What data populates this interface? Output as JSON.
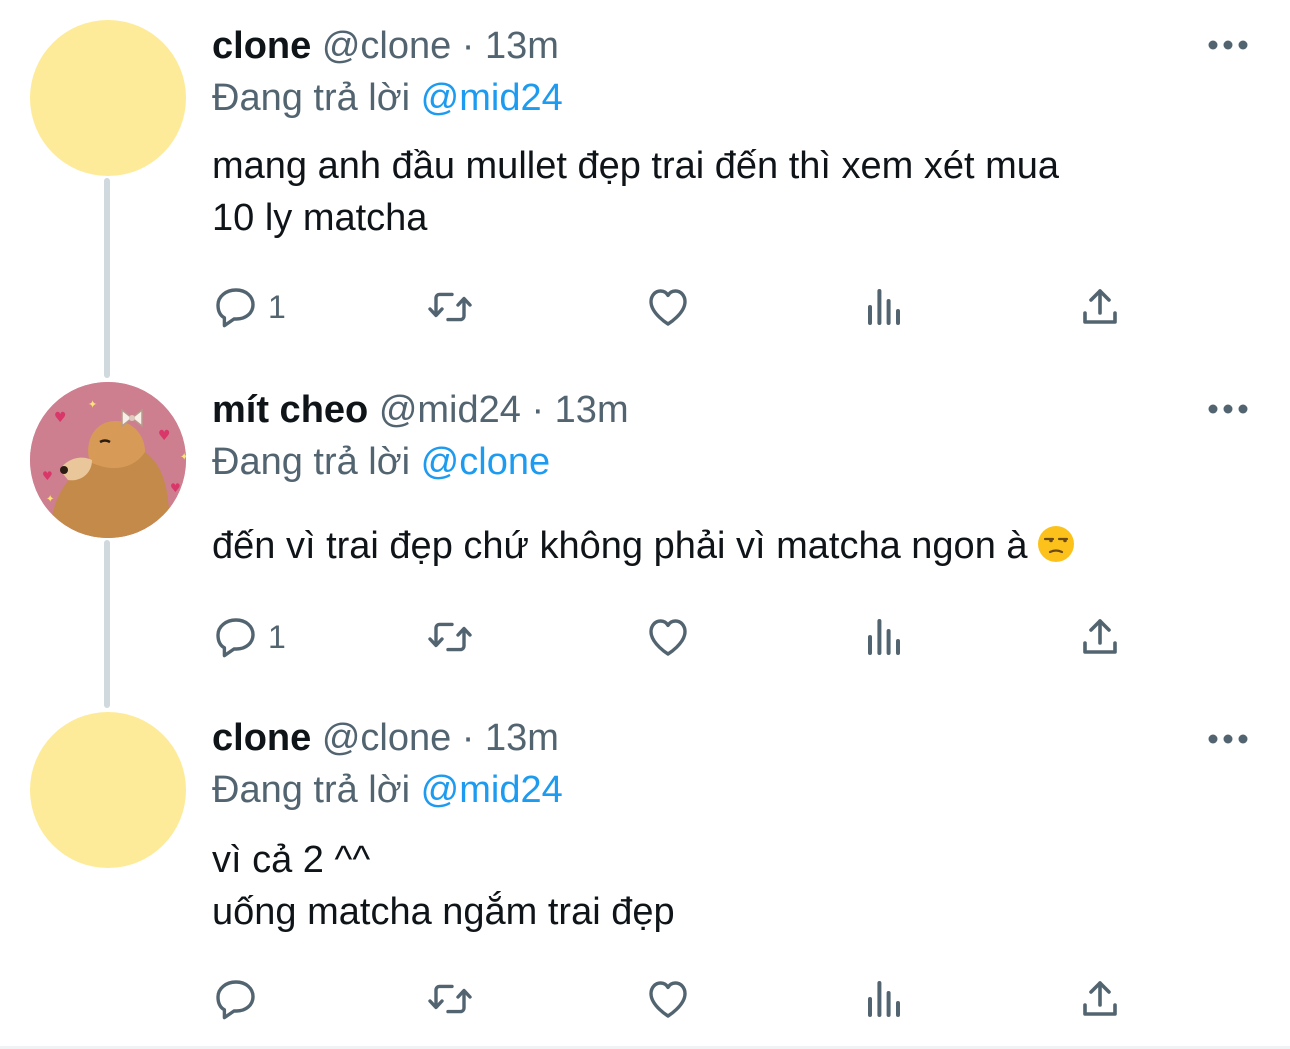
{
  "tweets": [
    {
      "name": "clone",
      "handle": "@clone",
      "separator": "·",
      "time": "13m",
      "reply_prefix": "Đang trả lời",
      "reply_to": "@mid24",
      "text_lines": [
        "mang anh đầu mullet đẹp trai đến thì xem xét mua",
        "10 ly matcha"
      ],
      "reply_count": "1"
    },
    {
      "name": "mít cheo",
      "handle": "@mid24",
      "separator": "·",
      "time": "13m",
      "reply_prefix": "Đang trả lời",
      "reply_to": "@clone",
      "text_lines": [
        "đến vì trai đẹp chứ không phải vì matcha ngon à"
      ],
      "emoji": "unamused-face",
      "reply_count": "1"
    },
    {
      "name": "clone",
      "handle": "@clone",
      "separator": "·",
      "time": "13m",
      "reply_prefix": "Đang trả lời",
      "reply_to": "@mid24",
      "text_lines": [
        "vì cả 2 ^^",
        "uống matcha ngắm trai đẹp"
      ],
      "reply_count": ""
    }
  ],
  "icons": {
    "reply": "reply-icon",
    "retweet": "retweet-icon",
    "like": "heart-icon",
    "views": "analytics-icon",
    "share": "share-icon",
    "more": "more-icon"
  },
  "colors": {
    "mention": "#1d9bf0",
    "secondary_text": "#536471",
    "avatar_plain": "#fdeb9a",
    "thread_line": "#cfd9de"
  }
}
